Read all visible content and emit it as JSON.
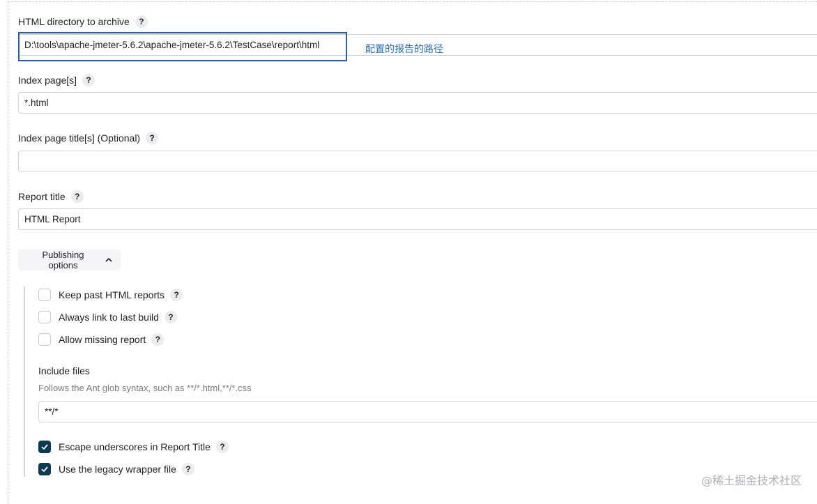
{
  "fields": {
    "html_dir": {
      "label": "HTML directory to archive",
      "value": "D:\\tools\\apache-jmeter-5.6.2\\apache-jmeter-5.6.2\\TestCase\\report\\html",
      "annotation": "配置的报告的路径"
    },
    "index_pages": {
      "label": "Index page[s]",
      "value": "*.html"
    },
    "index_titles": {
      "label": "Index page title[s] (Optional)",
      "value": ""
    },
    "report_title": {
      "label": "Report title",
      "value": "HTML Report"
    }
  },
  "help_glyph": "?",
  "publishing": {
    "button_label": "Publishing options",
    "chevron": "^",
    "checkboxes": [
      {
        "label": "Keep past HTML reports",
        "checked": false
      },
      {
        "label": "Always link to last build",
        "checked": false
      },
      {
        "label": "Allow missing report",
        "checked": false
      }
    ],
    "include_files": {
      "label": "Include files",
      "hint": "Follows the Ant glob syntax, such as **/*.html,**/*.css",
      "value": "**/*"
    },
    "checkboxes_bottom": [
      {
        "label": "Escape underscores in Report Title",
        "checked": true
      },
      {
        "label": "Use the legacy wrapper file",
        "checked": true
      }
    ]
  },
  "watermark": "@稀土掘金技术社区",
  "colors": {
    "accent": "#0b3a57",
    "highlight_border": "#1f5fb4",
    "annotation": "#1f6fd1"
  }
}
